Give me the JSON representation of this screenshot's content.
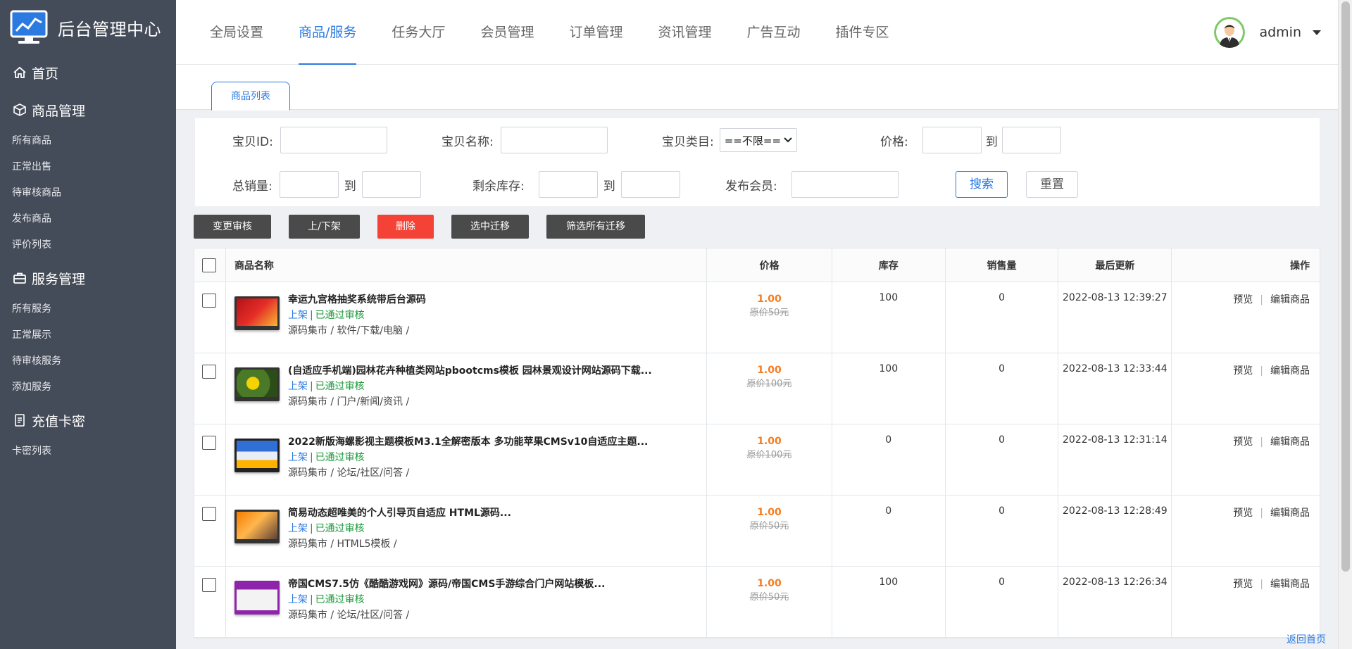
{
  "app": {
    "title": "后台管理中心"
  },
  "sidebar": {
    "home_label": "首页",
    "groups": [
      {
        "title": "商品管理",
        "icon": "cube-icon",
        "links": [
          "所有商品",
          "正常出售",
          "待审核商品",
          "发布商品",
          "评价列表"
        ]
      },
      {
        "title": "服务管理",
        "icon": "briefcase-icon",
        "links": [
          "所有服务",
          "正常展示",
          "待审核服务",
          "添加服务"
        ]
      },
      {
        "title": "充值卡密",
        "icon": "card-icon",
        "links": [
          "卡密列表"
        ]
      }
    ]
  },
  "header": {
    "tabs": [
      "全局设置",
      "商品/服务",
      "任务大厅",
      "会员管理",
      "订单管理",
      "资讯管理",
      "广告互动",
      "插件专区"
    ],
    "active_tab": "商品/服务",
    "username": "admin"
  },
  "subtab": {
    "label": "商品列表"
  },
  "filters": {
    "id_label": "宝贝ID:",
    "name_label": "宝贝名称:",
    "category_label": "宝贝类目:",
    "category_value": "==不限==",
    "price_label": "价格:",
    "to_label": "到",
    "sales_label": "总销量:",
    "stock_label": "剩余库存:",
    "member_label": "发布会员:",
    "search_button": "搜索",
    "reset_button": "重置"
  },
  "actions": [
    "变更审核",
    "上/下架",
    "删除",
    "选中迁移",
    "筛选所有迁移"
  ],
  "table": {
    "columns": [
      "商品名称",
      "价格",
      "库存",
      "销售量",
      "最后更新",
      "操作"
    ],
    "status_shelf": "上架",
    "status_separator": "|",
    "status_audit": "已通过审核",
    "op_preview": "预览",
    "op_edit": "编辑商品",
    "rows": [
      {
        "title": "幸运九宫格抽奖系统带后台源码",
        "category": "源码集市 / 软件/下载/电脑 /",
        "price": "1.00",
        "original": "原价50元",
        "stock": "100",
        "sales": "0",
        "updated": "2022-08-13 12:39:27"
      },
      {
        "title": "(自适应手机端)园林花卉种植类网站pbootcms模板 园林景观设计网站源码下载...",
        "category": "源码集市 / 门户/新闻/资讯 /",
        "price": "1.00",
        "original": "原价100元",
        "stock": "100",
        "sales": "0",
        "updated": "2022-08-13 12:33:44"
      },
      {
        "title": "2022新版海螺影视主题模板M3.1全解密版本 多功能苹果CMSv10自适应主题...",
        "category": "源码集市 / 论坛/社区/问答 /",
        "price": "1.00",
        "original": "原价100元",
        "stock": "0",
        "sales": "0",
        "updated": "2022-08-13 12:31:14"
      },
      {
        "title": "简易动态超唯美的个人引导页自适应 HTML源码...",
        "category": "源码集市 / HTML5模板 /",
        "price": "1.00",
        "original": "原价50元",
        "stock": "0",
        "sales": "0",
        "updated": "2022-08-13 12:28:49"
      },
      {
        "title": "帝国CMS7.5仿《酷酷游戏网》源码/帝国CMS手游综合门户网站模板...",
        "category": "源码集市 / 论坛/社区/问答 /",
        "price": "1.00",
        "original": "原价50元",
        "stock": "100",
        "sales": "0",
        "updated": "2022-08-13 12:26:34"
      }
    ]
  },
  "footer": {
    "back_home": "返回首页"
  },
  "colors": {
    "sidebar_bg": "#454c59",
    "accent": "#2a7ae2",
    "price": "#f57c1f",
    "danger": "#f44336",
    "audit_ok": "#1a9a3a"
  }
}
